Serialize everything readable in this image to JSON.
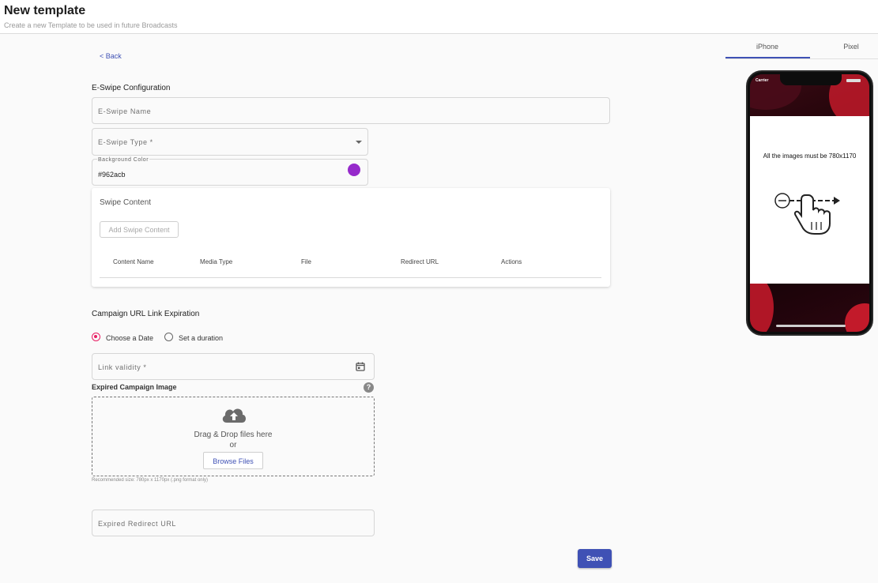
{
  "header": {
    "title": "New template",
    "subtitle": "Create a new Template to be used in future Broadcasts"
  },
  "back_label": "< Back",
  "eswipe": {
    "section_title": "E-Swipe Configuration",
    "name_label": "E-Swipe Name",
    "type_label": "E-Swipe Type *",
    "bg_color_label": "Background Color",
    "bg_color_value": "#962acb",
    "bg_color_swatch": "#962acb"
  },
  "swipe_content": {
    "title": "Swipe Content",
    "add_button": "Add Swipe Content",
    "columns": [
      "Content Name",
      "Media Type",
      "File",
      "Redirect URL",
      "Actions"
    ]
  },
  "campaign": {
    "section_title": "Campaign URL Link Expiration",
    "radio_options": [
      "Choose a Date",
      "Set a duration"
    ],
    "selected_option": "Choose a Date",
    "link_validity_label": "Link validity *",
    "expired_image_label": "Expired Campaign Image",
    "dropzone_text": "Drag & Drop files here",
    "dropzone_or": "or",
    "browse_button": "Browse Files",
    "recommended_note": "Recommended size: 780px x 1170px (.png format only)",
    "expired_redirect_label": "Expired Redirect URL"
  },
  "save_label": "Save",
  "preview": {
    "tabs": [
      "iPhone",
      "Pixel"
    ],
    "active_tab": "iPhone",
    "carrier": "Carrier",
    "message": "All the images must be 780x1170"
  },
  "colors": {
    "accent": "#3f51b5",
    "radio_selected": "#e91e63"
  },
  "icons": {
    "calendar": "calendar-icon",
    "help": "help-icon",
    "upload": "cloud-upload-icon",
    "swipe_hand": "swipe-gesture-icon"
  }
}
